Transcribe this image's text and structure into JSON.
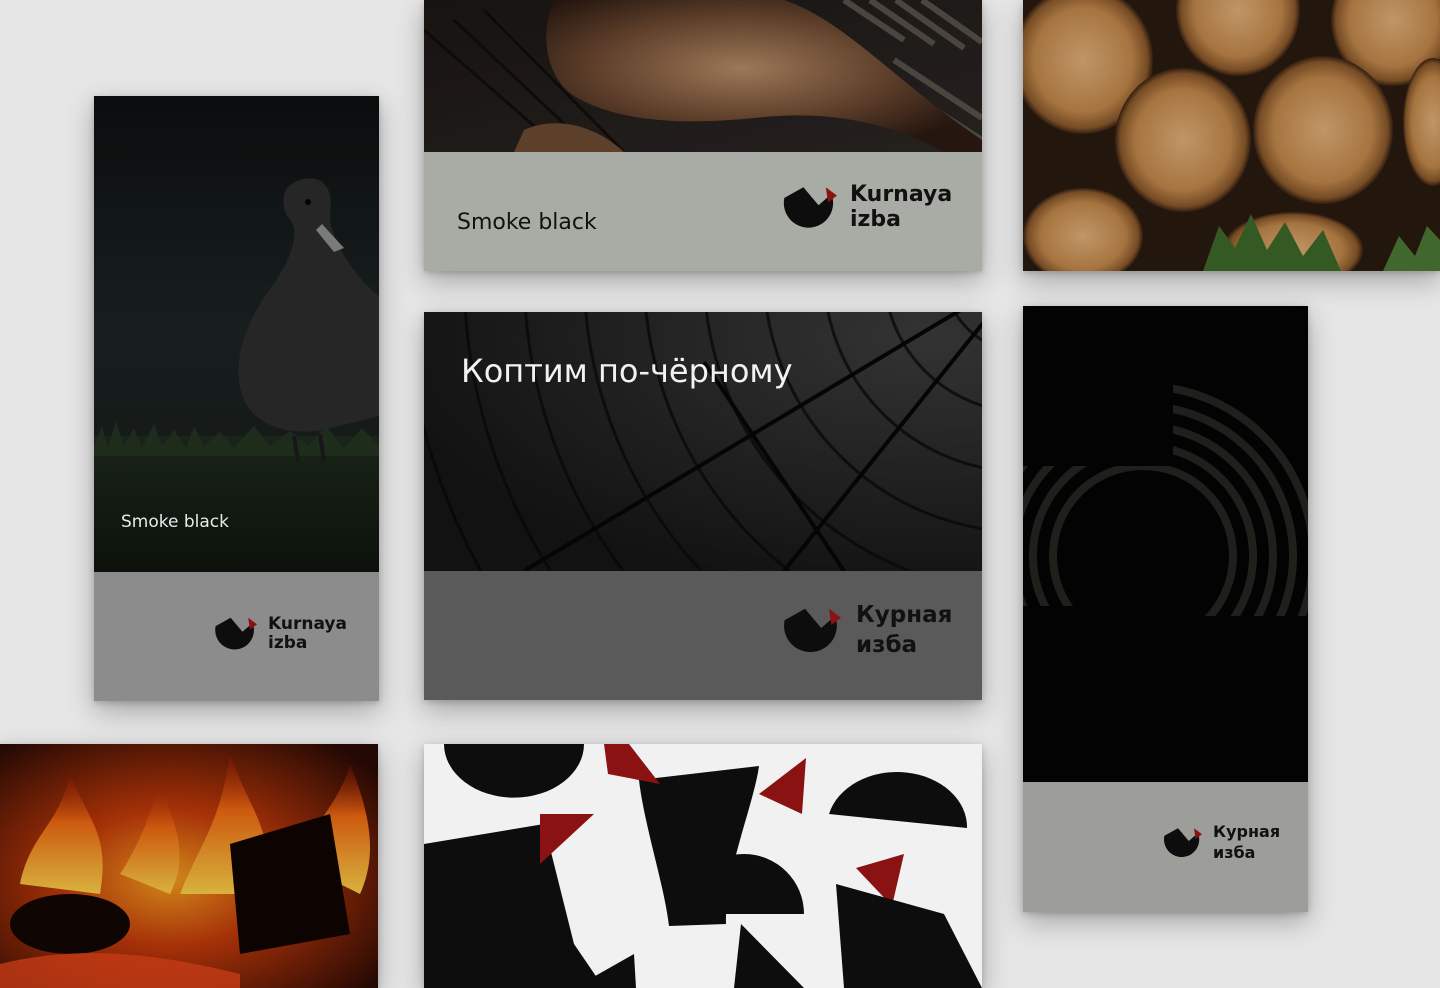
{
  "colors": {
    "background": "#e6e6e6",
    "band_light_gray": "#a9aca4",
    "band_mid_gray": "#8c8c8c",
    "band_dark_gray": "#5a5a5a",
    "logo_black": "#0d0d0d",
    "logo_red": "#8b1212"
  },
  "icons": {
    "brand_mark": "hen-logo-icon"
  },
  "tall_card_left": {
    "caption": "Smoke black",
    "logo_line1": "Kurnaya",
    "logo_line2": "izba"
  },
  "top_card": {
    "caption": "Smoke black",
    "logo_line1": "Kurnaya",
    "logo_line2": "izba"
  },
  "center_card": {
    "headline": "Коптим по-чёрному",
    "logo_line1": "Курная",
    "logo_line2": "изба"
  },
  "tall_card_right": {
    "logo_line1": "Курная",
    "logo_line2": "изба"
  }
}
